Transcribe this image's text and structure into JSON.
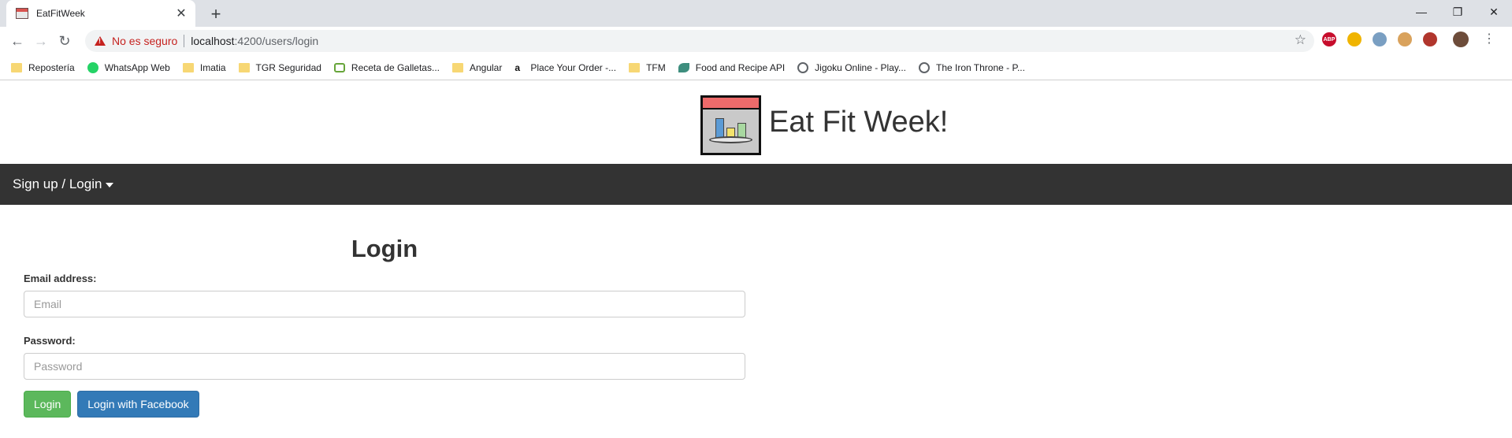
{
  "browser": {
    "tab": {
      "title": "EatFitWeek"
    },
    "window_controls": {
      "minimize": "—",
      "restore": "❐",
      "close": "✕"
    },
    "toolbar": {
      "security_label": "No es seguro",
      "url_host": "localhost",
      "url_path": ":4200/users/login"
    },
    "extensions": [
      "ABP",
      "",
      "",
      "",
      ""
    ],
    "bookmarks": [
      {
        "label": "Repostería",
        "icon": "folder-icon"
      },
      {
        "label": "WhatsApp Web",
        "icon": "whatsapp-icon"
      },
      {
        "label": "Imatia",
        "icon": "folder-icon"
      },
      {
        "label": "TGR Seguridad",
        "icon": "folder-icon"
      },
      {
        "label": "Receta de Galletas...",
        "icon": "tv-icon"
      },
      {
        "label": "Angular",
        "icon": "folder-icon"
      },
      {
        "label": "Place Your Order -...",
        "icon": "amazon-icon"
      },
      {
        "label": "TFM",
        "icon": "folder-icon"
      },
      {
        "label": "Food and Recipe API",
        "icon": "food-icon"
      },
      {
        "label": "Jigoku Online - Play...",
        "icon": "globe-icon"
      },
      {
        "label": "The Iron Throne - P...",
        "icon": "globe-icon"
      }
    ]
  },
  "site": {
    "title": "Eat Fit Week!",
    "nav": {
      "dropdown_label": "Sign up / Login"
    },
    "login": {
      "heading": "Login",
      "email_label": "Email address:",
      "email_placeholder": "Email",
      "password_label": "Password:",
      "password_placeholder": "Password",
      "login_button": "Login",
      "facebook_button": "Login with Facebook"
    },
    "colors": {
      "navbar": "#333333",
      "success": "#5cb85c",
      "primary": "#337ab7",
      "logo_top": "#ee6b6b"
    }
  }
}
